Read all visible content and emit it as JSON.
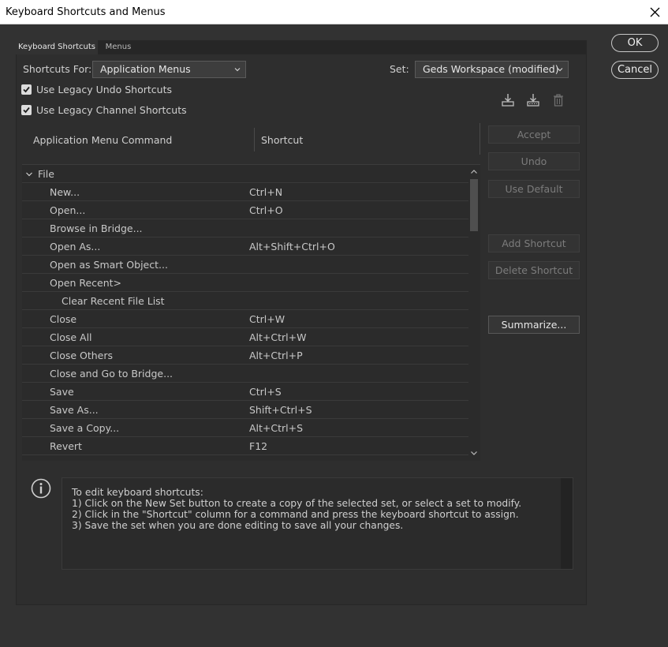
{
  "window": {
    "title": "Keyboard Shortcuts and Menus"
  },
  "tabs": [
    {
      "label": "Keyboard Shortcuts"
    },
    {
      "label": "Menus"
    }
  ],
  "dialog_buttons": {
    "ok": "OK",
    "cancel": "Cancel"
  },
  "shortcuts_for": {
    "label": "Shortcuts For:",
    "value": "Application Menus"
  },
  "set": {
    "label": "Set:",
    "value": "Geds Workspace (modified)"
  },
  "options": [
    {
      "label": "Use Legacy Undo Shortcuts",
      "checked": true
    },
    {
      "label": "Use Legacy Channel Shortcuts",
      "checked": true
    }
  ],
  "set_icons": [
    "save-set-icon",
    "save-set-as-icon",
    "delete-set-icon"
  ],
  "columns": {
    "command": "Application Menu Command",
    "shortcut": "Shortcut"
  },
  "tree": {
    "group": "File",
    "items": [
      {
        "command": "New...",
        "shortcut": "Ctrl+N"
      },
      {
        "command": "Open...",
        "shortcut": "Ctrl+O"
      },
      {
        "command": "Browse in Bridge...",
        "shortcut": ""
      },
      {
        "command": "Open As...",
        "shortcut": "Alt+Shift+Ctrl+O"
      },
      {
        "command": "Open as Smart Object...",
        "shortcut": ""
      },
      {
        "command": "Open Recent>",
        "shortcut": ""
      },
      {
        "command": "Clear Recent File List",
        "shortcut": "",
        "indent": true
      },
      {
        "command": "Close",
        "shortcut": "Ctrl+W"
      },
      {
        "command": "Close All",
        "shortcut": "Alt+Ctrl+W"
      },
      {
        "command": "Close Others",
        "shortcut": "Alt+Ctrl+P"
      },
      {
        "command": "Close and Go to Bridge...",
        "shortcut": ""
      },
      {
        "command": "Save",
        "shortcut": "Ctrl+S"
      },
      {
        "command": "Save As...",
        "shortcut": "Shift+Ctrl+S"
      },
      {
        "command": "Save a Copy...",
        "shortcut": "Alt+Ctrl+S"
      },
      {
        "command": "Revert",
        "shortcut": "F12"
      }
    ]
  },
  "side_buttons": {
    "accept": "Accept",
    "undo": "Undo",
    "use_default": "Use Default",
    "add_shortcut": "Add Shortcut",
    "delete_shortcut": "Delete Shortcut",
    "summarize": "Summarize..."
  },
  "info": {
    "icon": "info-icon",
    "lines": [
      "To edit keyboard shortcuts:",
      "1) Click on the New Set button to create a copy of the selected set, or select a set to modify.",
      "2) Click in the \"Shortcut\" column for a command and press the keyboard shortcut to assign.",
      "3) Save the set when you are done editing to save all your changes."
    ]
  },
  "colors": {
    "dialog_bg": "#323232",
    "panel_bg": "#2e2e2e",
    "list_bg": "#2b2b2b",
    "text": "#cfcfcf"
  }
}
